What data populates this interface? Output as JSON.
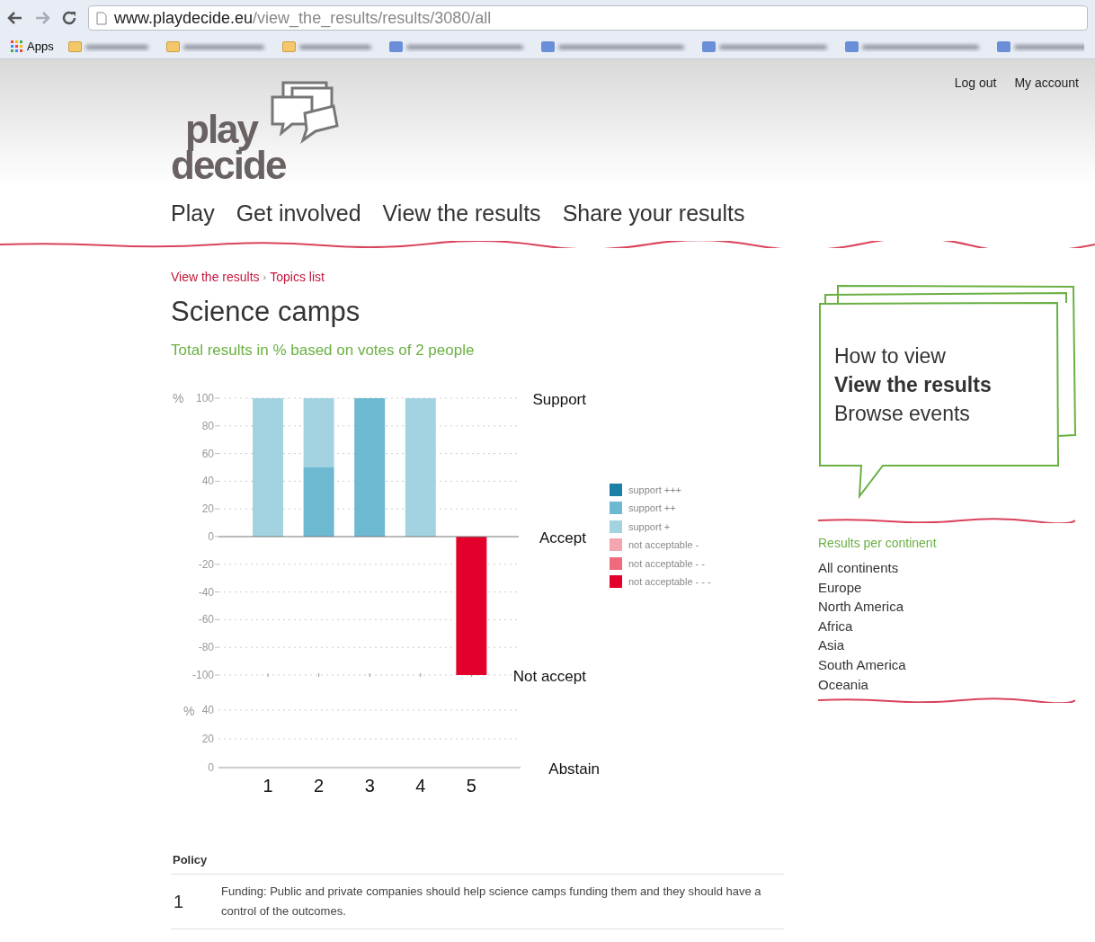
{
  "browser": {
    "url_domain": "www.playdecide.eu",
    "url_path": "/view_the_results/results/3080/all",
    "bookmarks_label": "Apps"
  },
  "header": {
    "logo_top": "play",
    "logo_bottom": "decide",
    "account_links": [
      "Log out",
      "My account"
    ]
  },
  "nav": [
    "Play",
    "Get involved",
    "View the results",
    "Share your results"
  ],
  "breadcrumb": [
    "View the results",
    "Topics list"
  ],
  "breadcrumb_separator": "›",
  "title": "Science camps",
  "subtitle": "Total results in % based on votes of 2 people",
  "chart_data": {
    "type": "bar",
    "stacked": true,
    "grid": true,
    "ylabel": "%",
    "categories": [
      "1",
      "2",
      "3",
      "4",
      "5"
    ],
    "ylim": [
      -100,
      100
    ],
    "yticks": [
      100,
      80,
      60,
      40,
      20,
      0,
      -20,
      -40,
      -60,
      -80,
      -100
    ],
    "series": [
      {
        "name": "support +++",
        "color": "#1b7fa6",
        "values": [
          0,
          0,
          0,
          0,
          0
        ]
      },
      {
        "name": "support ++",
        "color": "#6db9d1",
        "values": [
          0,
          50,
          100,
          0,
          0
        ]
      },
      {
        "name": "support +",
        "color": "#a3d3e1",
        "values": [
          100,
          50,
          0,
          100,
          0
        ]
      },
      {
        "name": "not acceptable -",
        "color": "#f4a6b0",
        "values": [
          0,
          0,
          0,
          0,
          0
        ]
      },
      {
        "name": "not acceptable - -",
        "color": "#ee6a7c",
        "values": [
          0,
          0,
          0,
          0,
          0
        ]
      },
      {
        "name": "not acceptable - - -",
        "color": "#e3002b",
        "values": [
          0,
          0,
          0,
          0,
          -100
        ]
      }
    ],
    "annotations": [
      "Support",
      "Accept",
      "Not accept"
    ]
  },
  "abstain_panel": {
    "unit": "%",
    "ticks": [
      "40",
      "20",
      "0"
    ],
    "label": "Abstain"
  },
  "sidebar": {
    "help_links": [
      {
        "label": "How to view",
        "selected": false
      },
      {
        "label": "View the results",
        "selected": true
      },
      {
        "label": "Browse events",
        "selected": false
      }
    ],
    "continents_title": "Results per continent",
    "continents": [
      "All continents",
      "Europe",
      "North America",
      "Africa",
      "Asia",
      "South America",
      "Oceania"
    ]
  },
  "policy_table": {
    "header": "Policy",
    "rows": [
      {
        "number": "1",
        "text": "Funding: Public and private companies should help science camps funding them and they should have a control of the outcomes."
      }
    ]
  }
}
